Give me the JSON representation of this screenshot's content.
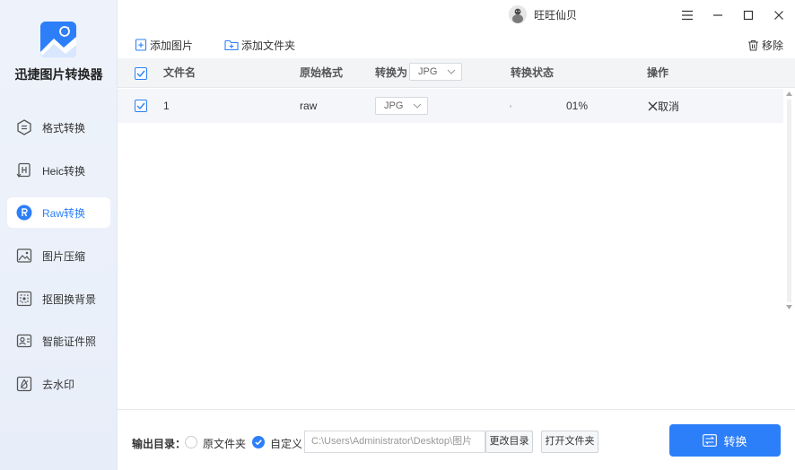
{
  "app": {
    "title": "迅捷图片转换器",
    "accent": "#2d7ff9"
  },
  "sidebar": {
    "items": [
      {
        "label": "格式转换",
        "icon": "format-convert-icon"
      },
      {
        "label": "Heic转换",
        "icon": "heic-icon"
      },
      {
        "label": "Raw转换",
        "icon": "raw-icon",
        "active": true
      },
      {
        "label": "图片压缩",
        "icon": "image-compress-icon"
      },
      {
        "label": "抠图换背景",
        "icon": "cutout-icon"
      },
      {
        "label": "智能证件照",
        "icon": "id-photo-icon"
      },
      {
        "label": "去水印",
        "icon": "remove-watermark-icon"
      }
    ]
  },
  "titlebar": {
    "username": "旺旺仙贝"
  },
  "toolbar": {
    "add_image": "添加图片",
    "add_folder": "添加文件夹",
    "remove": "移除"
  },
  "table": {
    "headers": {
      "filename": "文件名",
      "original_format": "原始格式",
      "convert_to": "转换为",
      "convert_to_value": "JPG",
      "status": "转换状态",
      "action": "操作"
    },
    "rows": [
      {
        "filename": "1",
        "original_format": "raw",
        "target_format": "JPG",
        "progress": "01%",
        "action": "取消"
      }
    ]
  },
  "footer": {
    "output_label": "输出目录：",
    "option_original": "原文件夹",
    "option_custom": "自定义",
    "selected_option": "自定义",
    "path": "C:\\Users\\Administrator\\Desktop\\图片",
    "change_dir": "更改目录",
    "open_folder": "打开文件夹",
    "convert": "转换"
  }
}
